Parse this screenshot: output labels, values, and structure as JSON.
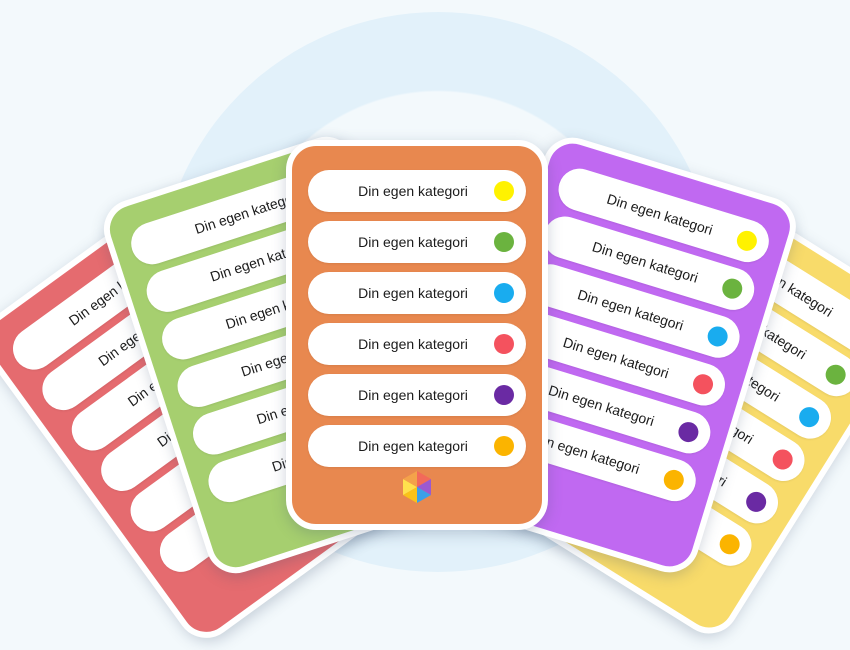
{
  "row_label": "Din egen kategori",
  "cards": [
    {
      "id": "card-red",
      "color": "#e56b6f"
    },
    {
      "id": "card-green",
      "color": "#a6cf6f"
    },
    {
      "id": "card-purple",
      "color": "#c069f1"
    },
    {
      "id": "card-yellow",
      "color": "#f8db6a"
    },
    {
      "id": "card-orange",
      "color": "#e8884f"
    }
  ],
  "dot_colors": [
    "#fff200",
    "#6bb33f",
    "#19acef",
    "#f4525e",
    "#6a2aa3",
    "#fbb400"
  ]
}
